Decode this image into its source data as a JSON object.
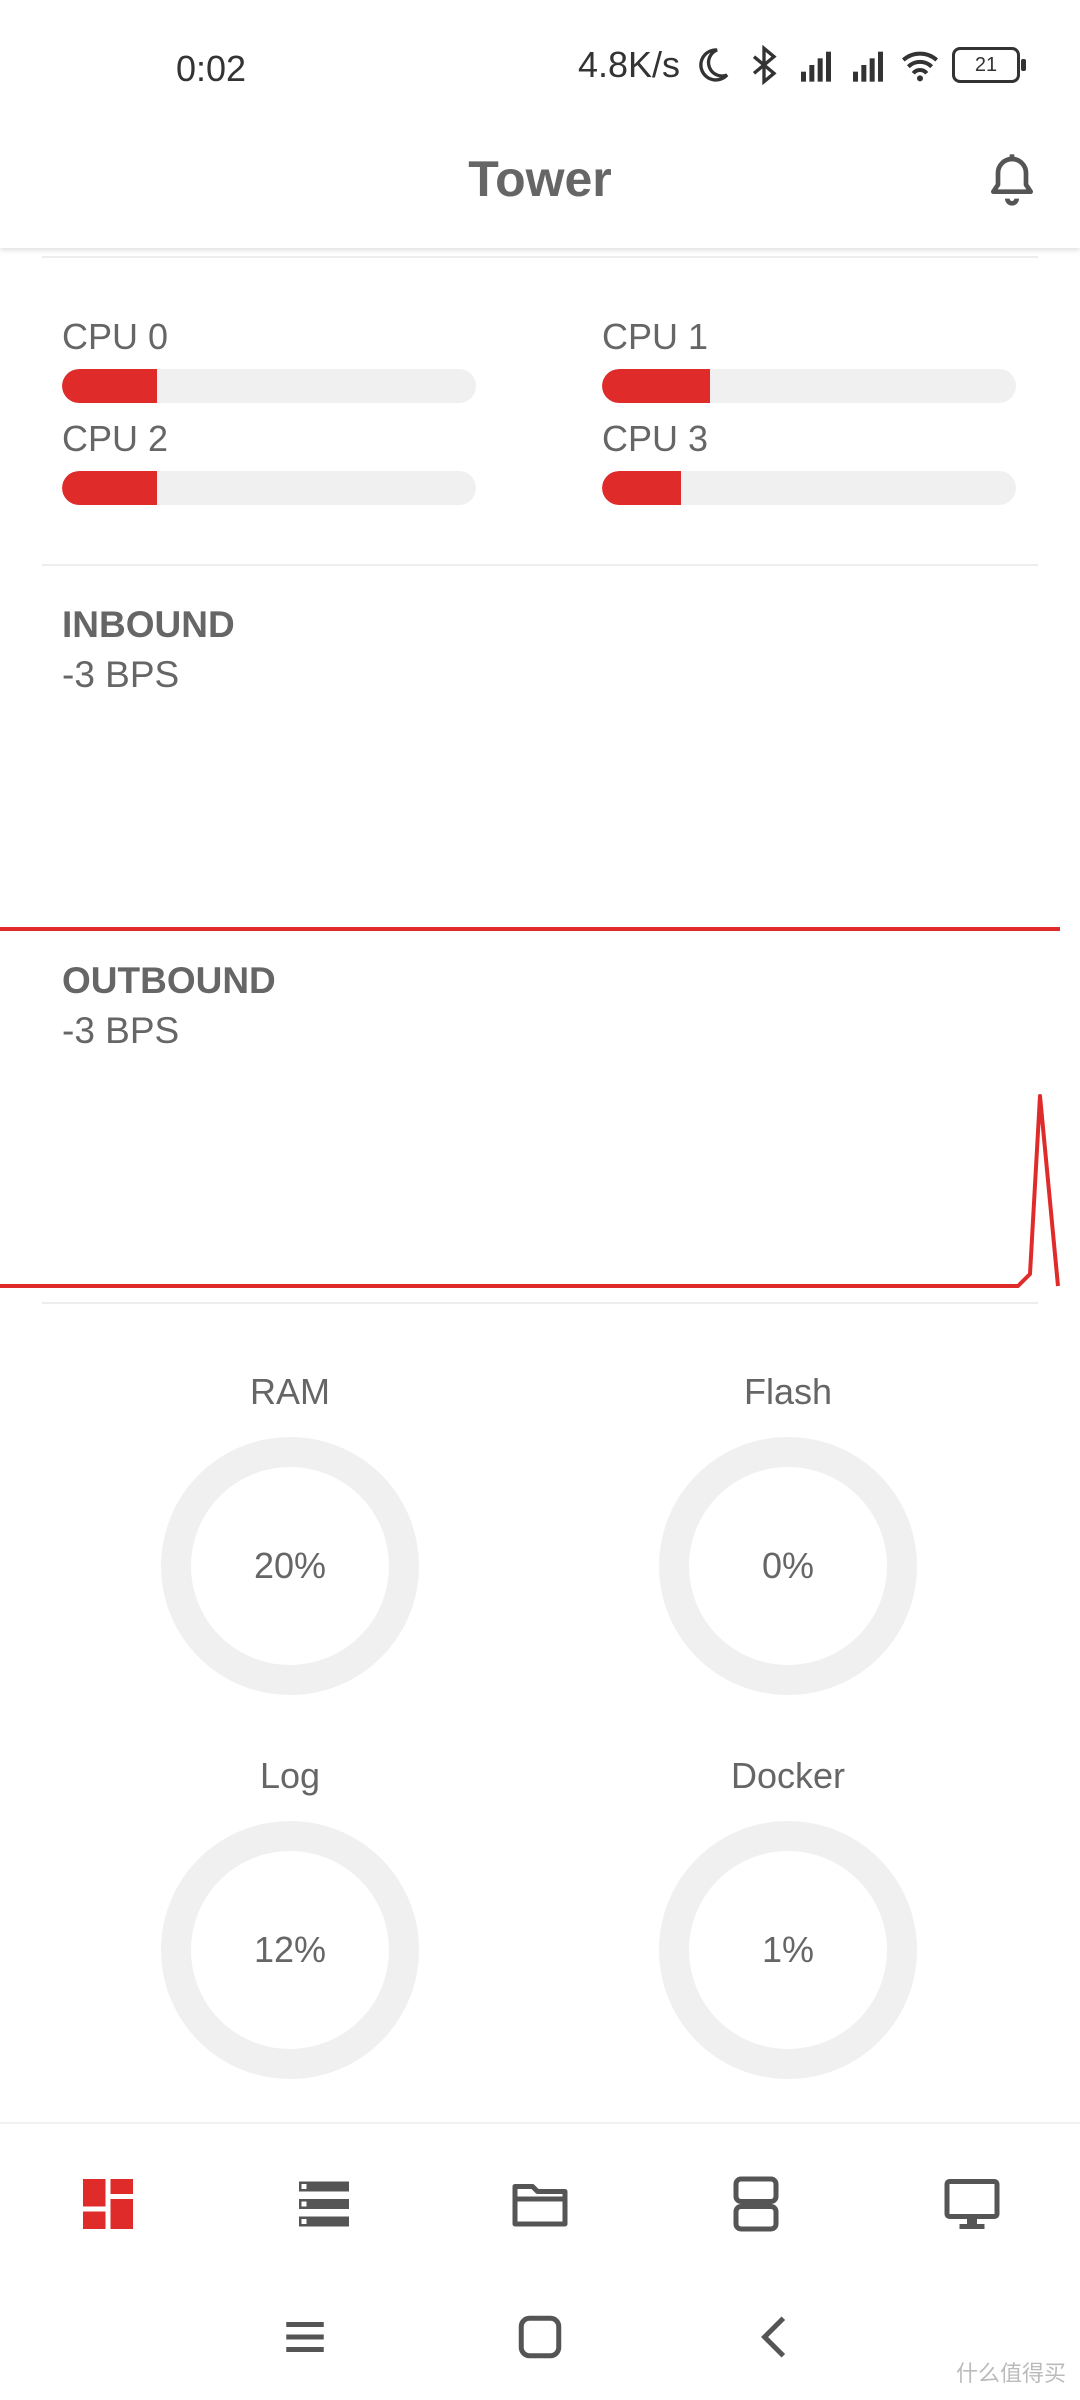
{
  "status_bar": {
    "time": "0:02",
    "net_speed": "4.8K/s",
    "battery": "21",
    "icons": [
      "moon-icon",
      "bluetooth-icon",
      "signal-hd-icon",
      "signal-hd-icon",
      "wifi-icon",
      "battery-icon"
    ]
  },
  "app_bar": {
    "title": "Tower",
    "notification_icon": "bell-icon"
  },
  "cpus": [
    {
      "label": "CPU 0",
      "usage": 0.23
    },
    {
      "label": "CPU 1",
      "usage": 0.26
    },
    {
      "label": "CPU 2",
      "usage": 0.23
    },
    {
      "label": "CPU 3",
      "usage": 0.19
    }
  ],
  "traffic": {
    "inbound": {
      "label": "INBOUND",
      "value": "-3 BPS"
    },
    "outbound": {
      "label": "OUTBOUND",
      "value": "-3 BPS"
    }
  },
  "storage": [
    {
      "label": "RAM",
      "value_text": "20%",
      "fraction": 0.2
    },
    {
      "label": "Flash",
      "value_text": "0%",
      "fraction": 0.0
    },
    {
      "label": "Log",
      "value_text": "12%",
      "fraction": 0.12
    },
    {
      "label": "Docker",
      "value_text": "1%",
      "fraction": 0.01
    }
  ],
  "bottom_nav": [
    {
      "icon": "dashboard-icon",
      "active": true
    },
    {
      "icon": "list-icon",
      "active": false
    },
    {
      "icon": "folder-icon",
      "active": false
    },
    {
      "icon": "server-icon",
      "active": false
    },
    {
      "icon": "monitor-icon",
      "active": false
    }
  ],
  "colors": {
    "accent": "#e02b2b",
    "track": "#f0f0f0",
    "text": "#666666"
  },
  "watermark": "什么值得买"
}
